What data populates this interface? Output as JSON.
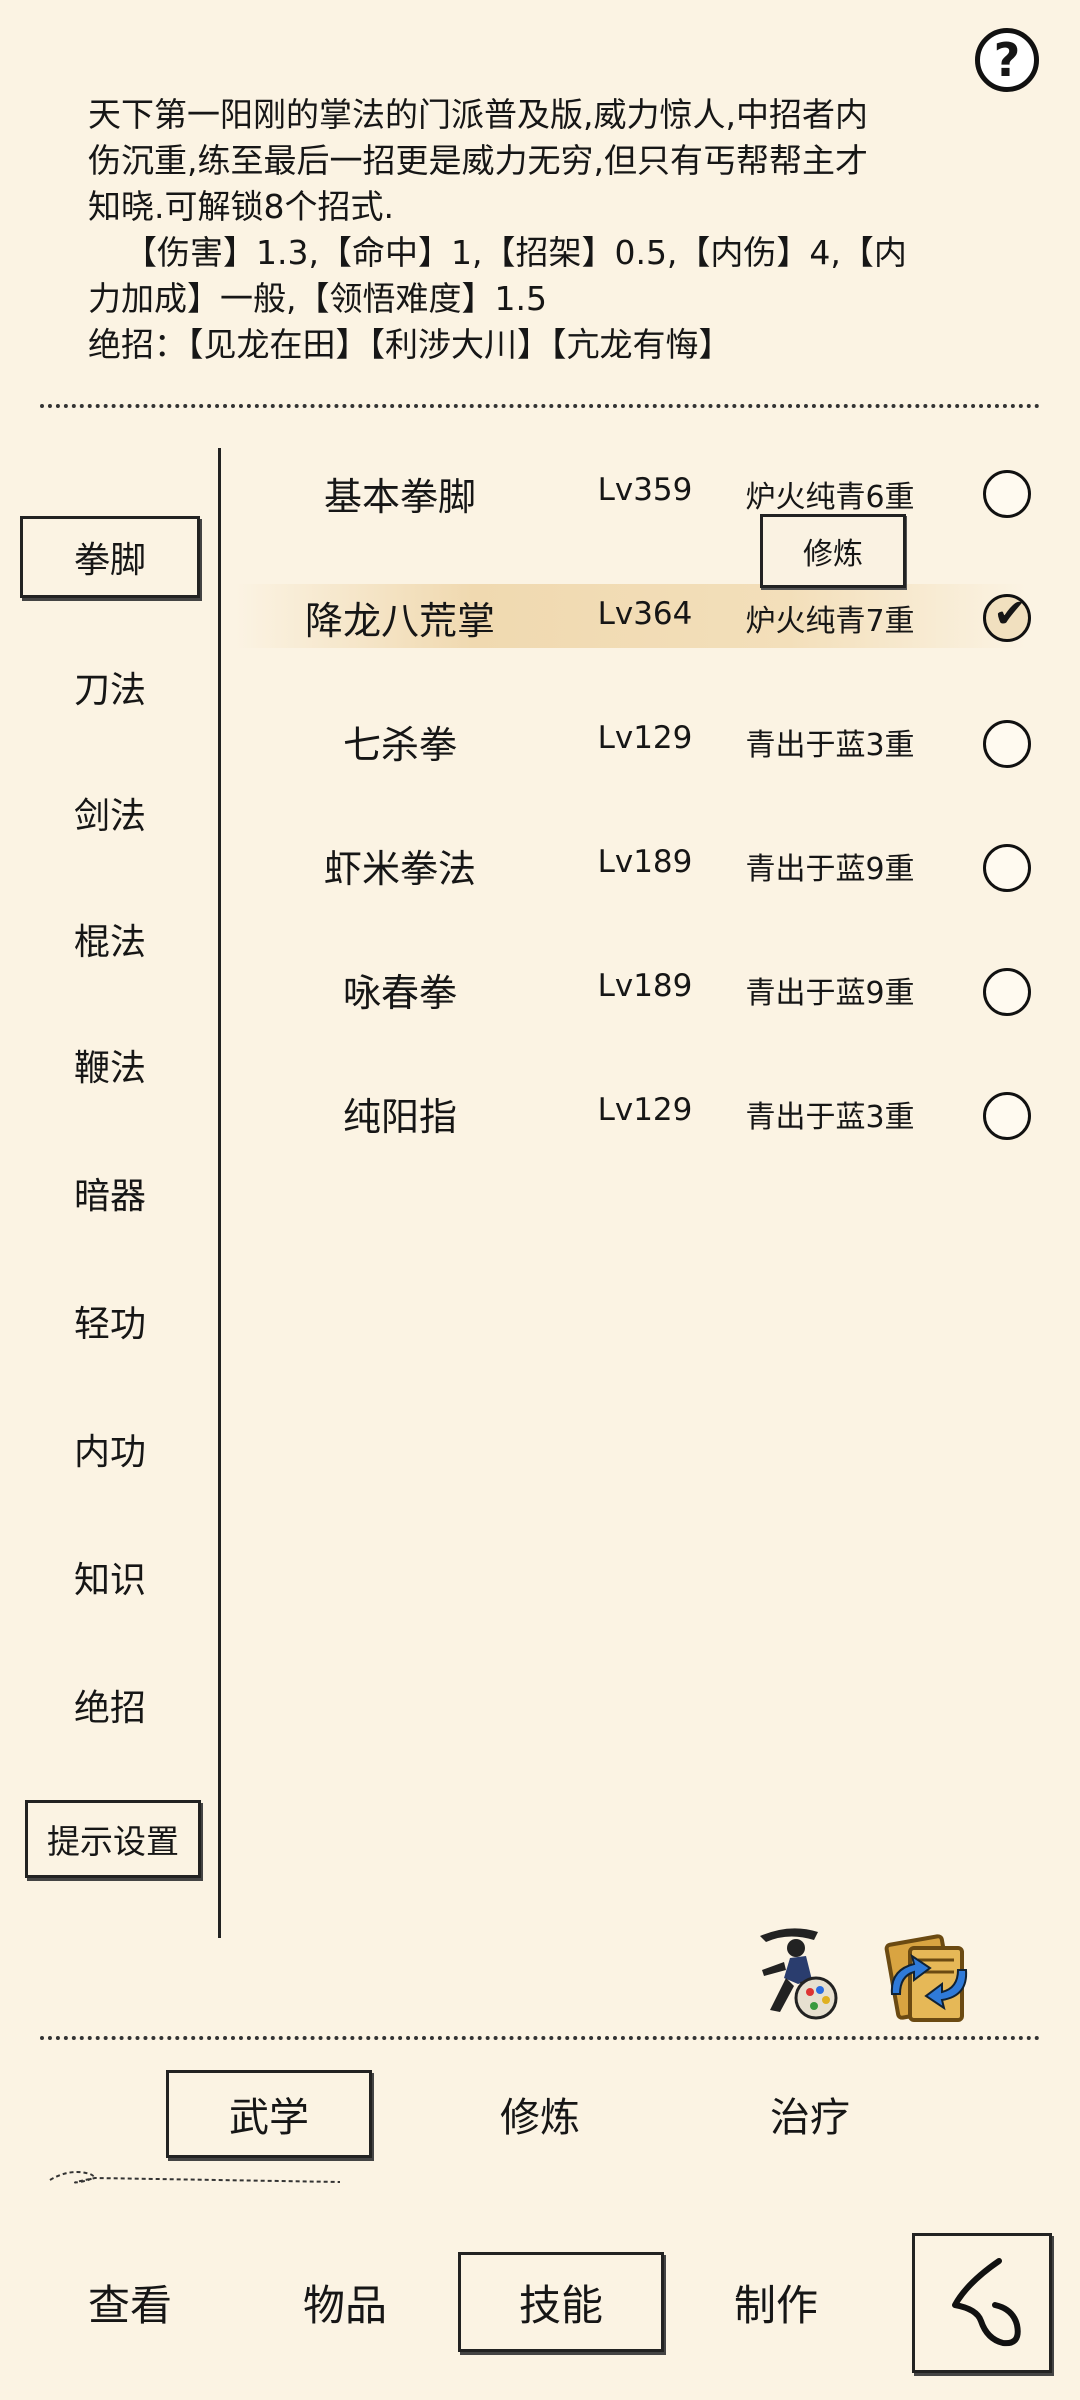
{
  "help": {
    "label": "?"
  },
  "description": {
    "lines": [
      "天下第一阳刚的掌法的门派普及版,威力惊人,中招者内",
      "伤沉重,练至最后一招更是威力无穷,但只有丐帮帮主才",
      "知晓.可解锁8个招式.",
      "【伤害】1.3,【命中】1,【招架】0.5,【内伤】4,【内",
      "力加成】一般,【领悟难度】1.5",
      "绝招：【见龙在田】【利涉大川】【亢龙有悔】"
    ]
  },
  "categories": [
    {
      "label": "拳脚",
      "active": true
    },
    {
      "label": "刀法"
    },
    {
      "label": "剑法"
    },
    {
      "label": "棍法"
    },
    {
      "label": "鞭法"
    },
    {
      "label": "暗器"
    },
    {
      "label": "轻功"
    },
    {
      "label": "内功"
    },
    {
      "label": "知识"
    },
    {
      "label": "绝招"
    }
  ],
  "hint_settings": {
    "label": "提示设置"
  },
  "train_button": {
    "label": "修炼"
  },
  "skills": [
    {
      "name": "基本拳脚",
      "level": "Lv359",
      "tier": "炉火纯青6重",
      "checked": false
    },
    {
      "name": "降龙八荒掌",
      "level": "Lv364",
      "tier": "炉火纯青7重",
      "checked": true
    },
    {
      "name": "七杀拳",
      "level": "Lv129",
      "tier": "青出于蓝3重",
      "checked": false
    },
    {
      "name": "虾米拳法",
      "level": "Lv189",
      "tier": "青出于蓝9重",
      "checked": false
    },
    {
      "name": "咏春拳",
      "level": "Lv189",
      "tier": "青出于蓝9重",
      "checked": false
    },
    {
      "name": "纯阳指",
      "level": "Lv129",
      "tier": "青出于蓝3重",
      "checked": false
    }
  ],
  "sub_tabs": [
    {
      "label": "武学",
      "active": true
    },
    {
      "label": "修炼"
    },
    {
      "label": "治疗"
    }
  ],
  "nav": [
    {
      "label": "查看"
    },
    {
      "label": "物品"
    },
    {
      "label": "技能",
      "active": true
    },
    {
      "label": "制作"
    }
  ],
  "colors": {
    "background": "#fbf3e3",
    "highlight": "#f0d9b0",
    "ink": "#161616"
  }
}
